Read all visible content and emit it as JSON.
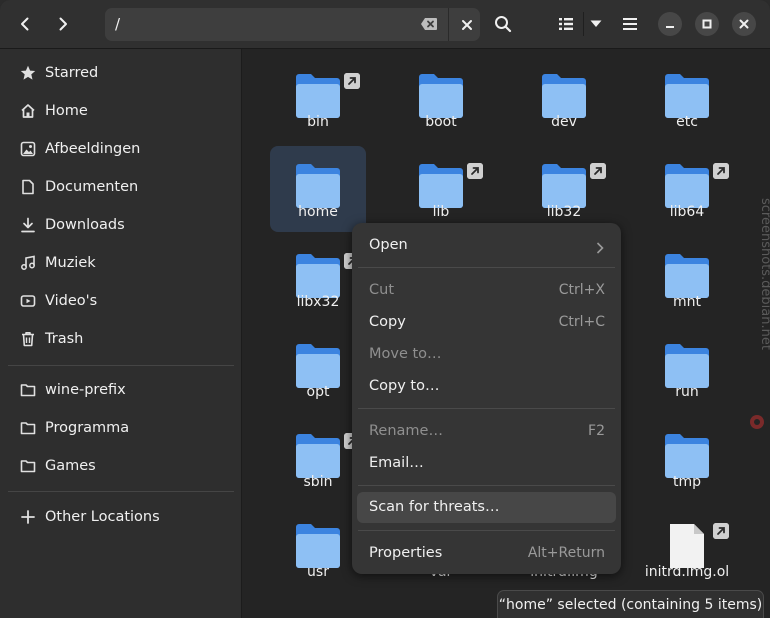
{
  "header": {
    "path": "/"
  },
  "sidebar": {
    "items": [
      {
        "label": "Starred",
        "icon": "star-icon"
      },
      {
        "label": "Home",
        "icon": "home-icon"
      },
      {
        "label": "Afbeeldingen",
        "icon": "image-icon"
      },
      {
        "label": "Documenten",
        "icon": "document-icon"
      },
      {
        "label": "Downloads",
        "icon": "download-icon"
      },
      {
        "label": "Muziek",
        "icon": "music-icon"
      },
      {
        "label": "Video's",
        "icon": "video-icon"
      },
      {
        "label": "Trash",
        "icon": "trash-icon"
      }
    ],
    "bookmarks": [
      {
        "label": "wine-prefix",
        "icon": "folder-icon"
      },
      {
        "label": "Programma",
        "icon": "folder-icon"
      },
      {
        "label": "Games",
        "icon": "folder-icon"
      }
    ],
    "other": {
      "label": "Other Locations",
      "icon": "plus-icon"
    }
  },
  "files": [
    {
      "name": "bin",
      "link": true
    },
    {
      "name": "boot",
      "link": false
    },
    {
      "name": "dev",
      "link": false
    },
    {
      "name": "etc",
      "link": false
    },
    {
      "name": "home",
      "link": false,
      "selected": true
    },
    {
      "name": "lib",
      "link": true
    },
    {
      "name": "lib32",
      "link": true
    },
    {
      "name": "lib64",
      "link": true
    },
    {
      "name": "libx32",
      "link": true
    },
    {
      "name": "",
      "link": false
    },
    {
      "name": "",
      "link": false
    },
    {
      "name": "mnt",
      "link": false
    },
    {
      "name": "opt",
      "link": false
    },
    {
      "name": "",
      "link": false
    },
    {
      "name": "",
      "link": false
    },
    {
      "name": "run",
      "link": false
    },
    {
      "name": "sbin",
      "link": true
    },
    {
      "name": "",
      "link": false
    },
    {
      "name": "",
      "link": false
    },
    {
      "name": "tmp",
      "link": false
    },
    {
      "name": "usr",
      "link": false
    },
    {
      "name": "var",
      "link": false
    },
    {
      "name": "initrd.img",
      "link": true,
      "file": true
    },
    {
      "name": "initrd.img.ol",
      "link": true,
      "file": true
    }
  ],
  "context_menu": {
    "open": "Open",
    "cut": "Cut",
    "cut_accel": "Ctrl+X",
    "copy": "Copy",
    "copy_accel": "Ctrl+C",
    "move_to": "Move to…",
    "copy_to": "Copy to…",
    "rename": "Rename…",
    "rename_accel": "F2",
    "email": "Email…",
    "scan": "Scan for threats…",
    "properties": "Properties",
    "properties_accel": "Alt+Return"
  },
  "status": "“home” selected  (containing 5 items)",
  "watermark": "screenshots.debian.net",
  "colors": {
    "accent_folder": "#7fb3f0",
    "folder_dark": "#3c84e0",
    "selection": "#2f3b4c"
  }
}
